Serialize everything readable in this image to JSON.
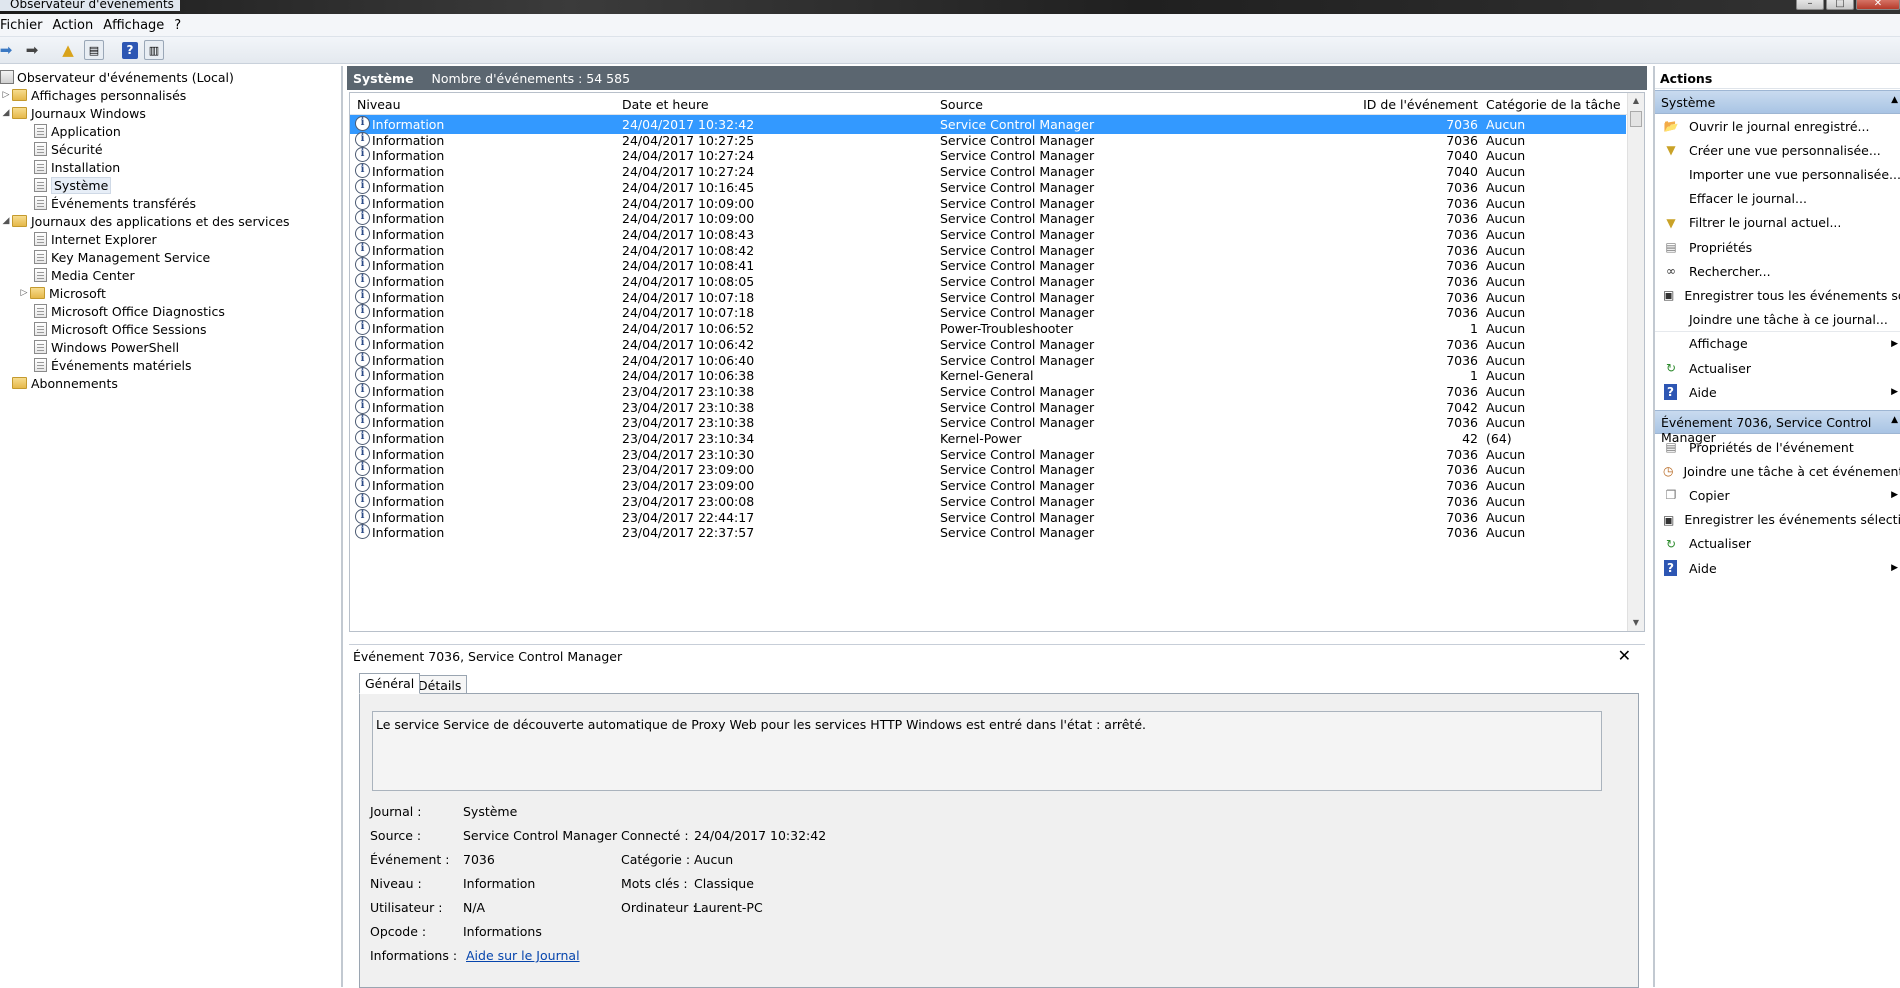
{
  "window": {
    "title": "Observateur d'événements"
  },
  "menu": [
    "Fichier",
    "Action",
    "Affichage",
    "?"
  ],
  "toolbar": {
    "icons": [
      "back-icon",
      "forward-icon",
      "open-folder-icon",
      "console-tree-icon",
      "help-icon",
      "action-pane-icon"
    ]
  },
  "tree": {
    "root": "Observateur d'événements (Local)",
    "custom_views": "Affichages personnalisés",
    "windows_logs": "Journaux Windows",
    "win_items": [
      "Application",
      "Sécurité",
      "Installation",
      "Système",
      "Événements transférés"
    ],
    "apps_services": "Journaux des applications et des services",
    "app_items": [
      "Internet Explorer",
      "Key Management Service",
      "Media Center",
      "Microsoft",
      "Microsoft Office Diagnostics",
      "Microsoft Office Sessions",
      "Windows PowerShell",
      "Événements matériels"
    ],
    "subscriptions": "Abonnements"
  },
  "center": {
    "title": "Système",
    "count": "Nombre d'événements : 54 585",
    "columns": [
      "Niveau",
      "Date et heure",
      "Source",
      "ID de l'événement",
      "Catégorie de la tâche"
    ],
    "rows": [
      [
        "Information",
        "24/04/2017 10:32:42",
        "Service Control Manager",
        "7036",
        "Aucun"
      ],
      [
        "Information",
        "24/04/2017 10:27:25",
        "Service Control Manager",
        "7036",
        "Aucun"
      ],
      [
        "Information",
        "24/04/2017 10:27:24",
        "Service Control Manager",
        "7040",
        "Aucun"
      ],
      [
        "Information",
        "24/04/2017 10:27:24",
        "Service Control Manager",
        "7040",
        "Aucun"
      ],
      [
        "Information",
        "24/04/2017 10:16:45",
        "Service Control Manager",
        "7036",
        "Aucun"
      ],
      [
        "Information",
        "24/04/2017 10:09:00",
        "Service Control Manager",
        "7036",
        "Aucun"
      ],
      [
        "Information",
        "24/04/2017 10:09:00",
        "Service Control Manager",
        "7036",
        "Aucun"
      ],
      [
        "Information",
        "24/04/2017 10:08:43",
        "Service Control Manager",
        "7036",
        "Aucun"
      ],
      [
        "Information",
        "24/04/2017 10:08:42",
        "Service Control Manager",
        "7036",
        "Aucun"
      ],
      [
        "Information",
        "24/04/2017 10:08:41",
        "Service Control Manager",
        "7036",
        "Aucun"
      ],
      [
        "Information",
        "24/04/2017 10:08:05",
        "Service Control Manager",
        "7036",
        "Aucun"
      ],
      [
        "Information",
        "24/04/2017 10:07:18",
        "Service Control Manager",
        "7036",
        "Aucun"
      ],
      [
        "Information",
        "24/04/2017 10:07:18",
        "Service Control Manager",
        "7036",
        "Aucun"
      ],
      [
        "Information",
        "24/04/2017 10:06:52",
        "Power-Troubleshooter",
        "1",
        "Aucun"
      ],
      [
        "Information",
        "24/04/2017 10:06:42",
        "Service Control Manager",
        "7036",
        "Aucun"
      ],
      [
        "Information",
        "24/04/2017 10:06:40",
        "Service Control Manager",
        "7036",
        "Aucun"
      ],
      [
        "Information",
        "24/04/2017 10:06:38",
        "Kernel-General",
        "1",
        "Aucun"
      ],
      [
        "Information",
        "23/04/2017 23:10:38",
        "Service Control Manager",
        "7036",
        "Aucun"
      ],
      [
        "Information",
        "23/04/2017 23:10:38",
        "Service Control Manager",
        "7042",
        "Aucun"
      ],
      [
        "Information",
        "23/04/2017 23:10:38",
        "Service Control Manager",
        "7036",
        "Aucun"
      ],
      [
        "Information",
        "23/04/2017 23:10:34",
        "Kernel-Power",
        "42",
        "(64)"
      ],
      [
        "Information",
        "23/04/2017 23:10:30",
        "Service Control Manager",
        "7036",
        "Aucun"
      ],
      [
        "Information",
        "23/04/2017 23:09:00",
        "Service Control Manager",
        "7036",
        "Aucun"
      ],
      [
        "Information",
        "23/04/2017 23:09:00",
        "Service Control Manager",
        "7036",
        "Aucun"
      ],
      [
        "Information",
        "23/04/2017 23:00:08",
        "Service Control Manager",
        "7036",
        "Aucun"
      ],
      [
        "Information",
        "23/04/2017 22:44:17",
        "Service Control Manager",
        "7036",
        "Aucun"
      ],
      [
        "Information",
        "23/04/2017 22:37:57",
        "Service Control Manager",
        "7036",
        "Aucun"
      ]
    ]
  },
  "detail": {
    "title": "Événement 7036, Service Control Manager",
    "tabs": [
      "Général",
      "Détails"
    ],
    "description": "Le service Service de découverte automatique de Proxy Web pour les services HTTP Windows est entré dans l'état : arrêté.",
    "left_labels": [
      "Journal :",
      "Source :",
      "Événement :",
      "Niveau :",
      "Utilisateur :",
      "Opcode :",
      "Informations :"
    ],
    "left_values": [
      "Système",
      "Service Control Manager",
      "7036",
      "Information",
      "N/A",
      "Informations",
      "Aide sur le Journal"
    ],
    "right_labels": [
      "Connecté :",
      "Catégorie :",
      "Mots clés :",
      "Ordinateur :"
    ],
    "right_values": [
      "24/04/2017 10:32:42",
      "Aucun",
      "Classique",
      "Laurent-PC"
    ]
  },
  "actions": {
    "header": "Actions",
    "section1": "Système",
    "items1": [
      {
        "label": "Ouvrir le journal enregistré...",
        "icon": "open-folder-icon"
      },
      {
        "label": "Créer une vue personnalisée...",
        "icon": "filter-icon"
      },
      {
        "label": "Importer une vue personnalisée...",
        "icon": ""
      },
      {
        "label": "Effacer le journal...",
        "icon": ""
      },
      {
        "label": "Filtrer le journal actuel...",
        "icon": "filter-icon"
      },
      {
        "label": "Propriétés",
        "icon": "properties-icon"
      },
      {
        "label": "Rechercher...",
        "icon": "binoculars-icon"
      },
      {
        "label": "Enregistrer tous les événements sou...",
        "icon": "save-icon"
      },
      {
        "label": "Joindre une tâche à ce journal...",
        "icon": ""
      },
      {
        "label": "Affichage",
        "icon": "",
        "submenu": true
      },
      {
        "label": "Actualiser",
        "icon": "refresh-icon"
      },
      {
        "label": "Aide",
        "icon": "help-icon",
        "submenu": true
      }
    ],
    "section2": "Événement 7036, Service Control Manager",
    "items2": [
      {
        "label": "Propriétés de l'événement",
        "icon": "properties-icon"
      },
      {
        "label": "Joindre une tâche à cet événement...",
        "icon": "task-icon"
      },
      {
        "label": "Copier",
        "icon": "copy-icon",
        "submenu": true
      },
      {
        "label": "Enregistrer les événements sélectio...",
        "icon": "save-icon"
      },
      {
        "label": "Actualiser",
        "icon": "refresh-icon"
      },
      {
        "label": "Aide",
        "icon": "help-icon",
        "submenu": true
      }
    ]
  },
  "colors": {
    "selection": "#3399ff",
    "header_bar": "#5b6670",
    "section_header": "#b8cfea",
    "link": "#0645ad"
  }
}
